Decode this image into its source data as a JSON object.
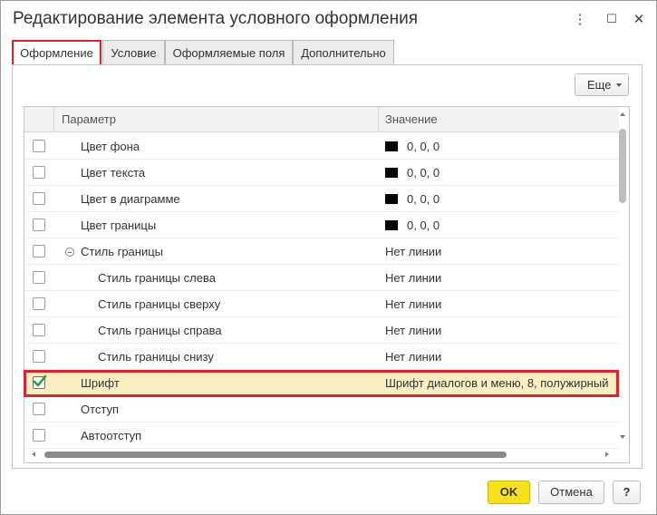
{
  "window": {
    "title": "Редактирование элемента условного оформления",
    "menu_glyph": "⋮",
    "maximize_glyph": "☐",
    "close_glyph": "✕"
  },
  "tabs": [
    {
      "label": "Оформление",
      "active": true
    },
    {
      "label": "Условие",
      "active": false
    },
    {
      "label": "Оформляемые поля",
      "active": false
    },
    {
      "label": "Дополнительно",
      "active": false
    }
  ],
  "toolbar": {
    "more_label": "Еще"
  },
  "grid": {
    "columns": {
      "parameter": "Параметр",
      "value": "Значение"
    },
    "rows": [
      {
        "checked": false,
        "label": "Цвет фона",
        "value": "0, 0, 0",
        "swatch": "#000000",
        "indent": 0
      },
      {
        "checked": false,
        "label": "Цвет текста",
        "value": "0, 0, 0",
        "swatch": "#000000",
        "indent": 0
      },
      {
        "checked": false,
        "label": "Цвет в диаграмме",
        "value": "0, 0, 0",
        "swatch": "#000000",
        "indent": 0
      },
      {
        "checked": false,
        "label": "Цвет границы",
        "value": "0, 0, 0",
        "swatch": "#000000",
        "indent": 0
      },
      {
        "checked": false,
        "label": "Стиль границы",
        "value": "Нет линии",
        "indent": 0,
        "group": true,
        "expanded": true
      },
      {
        "checked": false,
        "label": "Стиль границы слева",
        "value": "Нет линии",
        "indent": 1
      },
      {
        "checked": false,
        "label": "Стиль границы сверху",
        "value": "Нет линии",
        "indent": 1
      },
      {
        "checked": false,
        "label": "Стиль границы справа",
        "value": "Нет линии",
        "indent": 1
      },
      {
        "checked": false,
        "label": "Стиль границы снизу",
        "value": "Нет линии",
        "indent": 1
      },
      {
        "checked": true,
        "label": "Шрифт",
        "value": "Шрифт диалогов и меню, 8, полужирный",
        "indent": 0,
        "selected": true
      },
      {
        "checked": false,
        "label": "Отступ",
        "value": "",
        "indent": 0
      },
      {
        "checked": false,
        "label": "Автоотступ",
        "value": "",
        "indent": 0
      }
    ]
  },
  "footer": {
    "ok_label": "OK",
    "cancel_label": "Отмена",
    "help_label": "?"
  },
  "colors": {
    "highlight": "#d9232d",
    "ok_button": "#f7e11a",
    "selected_row": "#fbefc1",
    "check_mark": "#2e9a3a"
  }
}
